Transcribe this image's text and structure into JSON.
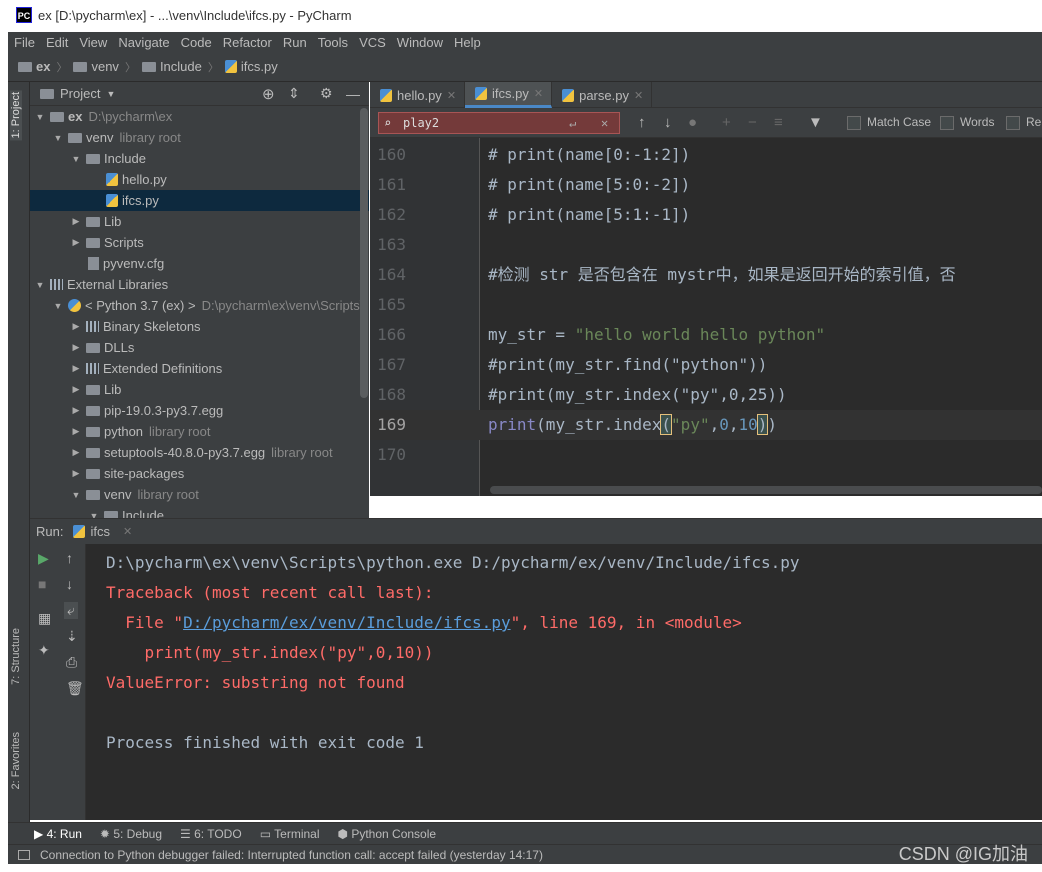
{
  "window": {
    "title": "ex [D:\\pycharm\\ex] - ...\\venv\\Include\\ifcs.py - PyCharm",
    "logo": "PC"
  },
  "menu": [
    "File",
    "Edit",
    "View",
    "Navigate",
    "Code",
    "Refactor",
    "Run",
    "Tools",
    "VCS",
    "Window",
    "Help"
  ],
  "breadcrumb": [
    "ex",
    "venv",
    "Include",
    "ifcs.py"
  ],
  "left_strip": {
    "project_tab": "1: Project",
    "structure_tab": "7: Structure",
    "favorites_tab": "2: Favorites"
  },
  "project": {
    "header": "Project",
    "rows": [
      {
        "label": "ex",
        "sub": "D:\\pycharm\\ex"
      },
      {
        "label": "venv",
        "sub": "library root"
      },
      {
        "label": "Include",
        "sub": ""
      },
      {
        "label": "hello.py",
        "sub": ""
      },
      {
        "label": "ifcs.py",
        "sub": ""
      },
      {
        "label": "Lib",
        "sub": ""
      },
      {
        "label": "Scripts",
        "sub": ""
      },
      {
        "label": "pyvenv.cfg",
        "sub": ""
      },
      {
        "label": "External Libraries",
        "sub": ""
      },
      {
        "label": "< Python 3.7 (ex) >",
        "sub": "D:\\pycharm\\ex\\venv\\Scripts\\"
      },
      {
        "label": "Binary Skeletons",
        "sub": ""
      },
      {
        "label": "DLLs",
        "sub": ""
      },
      {
        "label": "Extended Definitions",
        "sub": ""
      },
      {
        "label": "Lib",
        "sub": ""
      },
      {
        "label": "pip-19.0.3-py3.7.egg",
        "sub": ""
      },
      {
        "label": "python",
        "sub": "library root"
      },
      {
        "label": "setuptools-40.8.0-py3.7.egg",
        "sub": "library root"
      },
      {
        "label": "site-packages",
        "sub": ""
      },
      {
        "label": "venv",
        "sub": "library root"
      },
      {
        "label": "Include",
        "sub": ""
      }
    ]
  },
  "tabs": [
    {
      "label": "hello.py"
    },
    {
      "label": "ifcs.py"
    },
    {
      "label": "parse.py"
    }
  ],
  "find": {
    "query": "play2",
    "match_case": "Match Case",
    "words": "Words",
    "regex": "Re"
  },
  "editor": {
    "lines": [
      {
        "num": "160",
        "text": "# print(name[0:-1:2])"
      },
      {
        "num": "161",
        "text": "# print(name[5:0:-2])"
      },
      {
        "num": "162",
        "text": "# print(name[5:1:-1])"
      },
      {
        "num": "163",
        "text": ""
      },
      {
        "num": "164",
        "text": "#检测 str 是否包含在 mystr中，如果是返回开始的索引值，否"
      },
      {
        "num": "165",
        "text": ""
      },
      {
        "num": "166",
        "text_a": "my_str = ",
        "text_b": "\"hello world hello python\""
      },
      {
        "num": "167",
        "text": "#print(my_str.find(\"python\"))"
      },
      {
        "num": "168",
        "text": "#print(my_str.index(\"py\",0,25))"
      },
      {
        "num": "169",
        "p1": "print",
        "p2": "(my_str.index",
        "p3": "(",
        "p4": "\"py\"",
        "p5": ",",
        "p6": "0",
        "p7": ",",
        "p8": "10",
        "p9": ")",
        "p10": ")"
      },
      {
        "num": "170",
        "text": ""
      }
    ]
  },
  "run": {
    "label": "Run:",
    "tab": "ifcs",
    "cmd": "D:\\pycharm\\ex\\venv\\Scripts\\python.exe D:/pycharm/ex/venv/Include/ifcs.py",
    "tb": "Traceback (most recent call last):",
    "file_pre": "  File \"",
    "file_link": "D:/pycharm/ex/venv/Include/ifcs.py",
    "file_post": "\", line 169, in <module>",
    "src": "    print(my_str.index(\"py\",0,10))",
    "error": "ValueError: substring not found",
    "exit": "Process finished with exit code 1"
  },
  "bottom_tabs": [
    "4: Run",
    "5: Debug",
    "6: TODO",
    "Terminal",
    "Python Console"
  ],
  "status": "Connection to Python debugger failed: Interrupted function call: accept failed (yesterday 14:17)",
  "watermark": "CSDN @IG加油"
}
